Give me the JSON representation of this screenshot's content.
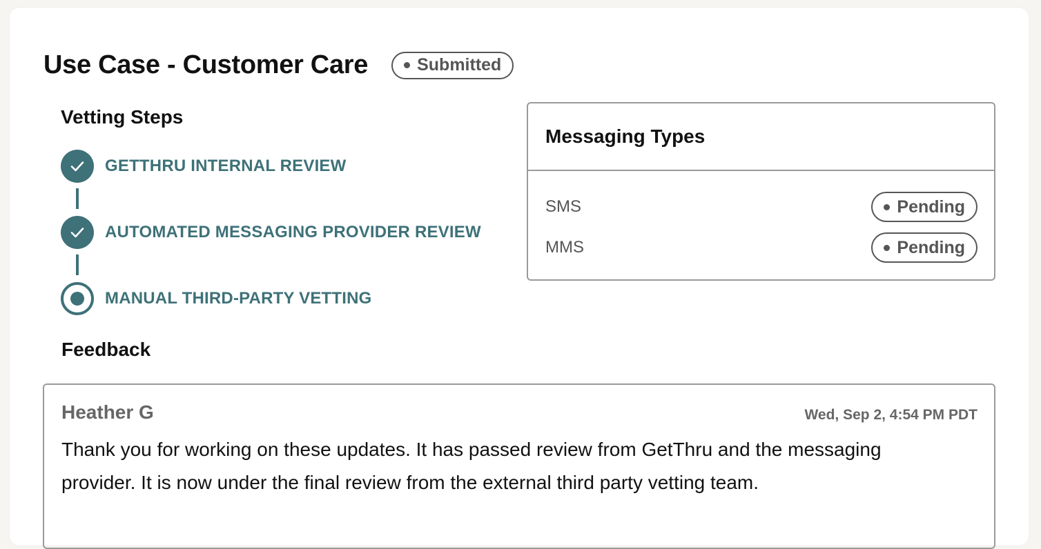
{
  "header": {
    "title": "Use Case - Customer Care",
    "status": "Submitted"
  },
  "vetting": {
    "heading": "Vetting Steps",
    "steps": [
      {
        "label": "GETTHRU INTERNAL REVIEW",
        "state": "complete",
        "icon": "check-icon"
      },
      {
        "label": "AUTOMATED MESSAGING PROVIDER REVIEW",
        "state": "complete",
        "icon": "check-icon"
      },
      {
        "label": "MANUAL THIRD-PARTY VETTING",
        "state": "current",
        "icon": "radio-dot-icon"
      }
    ]
  },
  "messaging": {
    "heading": "Messaging Types",
    "rows": [
      {
        "type": "SMS",
        "status": "Pending"
      },
      {
        "type": "MMS",
        "status": "Pending"
      }
    ]
  },
  "feedback": {
    "heading": "Feedback",
    "entries": [
      {
        "author": "Heather G",
        "timestamp": "Wed, Sep 2, 4:54 PM PDT",
        "message": "Thank you for working on these updates. It has passed review from GetThru and the messaging provider. It is now under the final review from the external third party vetting team."
      }
    ]
  },
  "colors": {
    "accent": "#3e7178",
    "status_gray": "#555555",
    "border": "#9a9a9a",
    "background": "#f6f5f2"
  }
}
